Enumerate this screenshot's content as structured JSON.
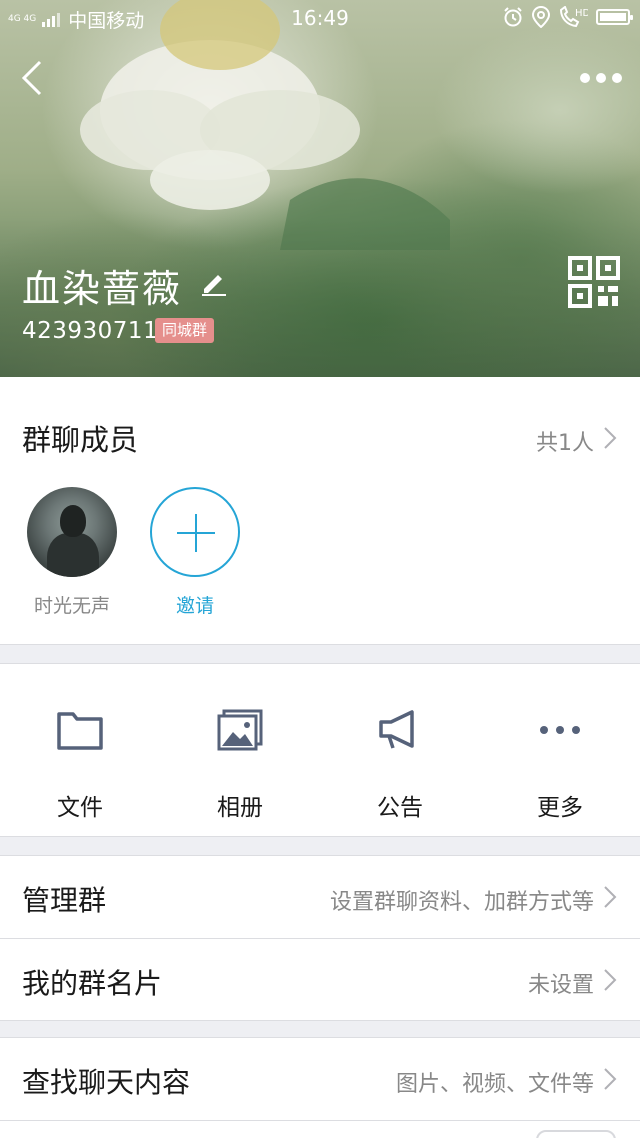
{
  "status_bar": {
    "network": "4G 4G",
    "carrier": "中国移动",
    "time": "16:49",
    "indicators": [
      "alarm-icon",
      "location-icon",
      "call-hd-icon",
      "battery-icon"
    ],
    "hd_label": "HD"
  },
  "header": {
    "group_name": "血染蔷薇",
    "group_id": "423930711",
    "badge": "同城群"
  },
  "members": {
    "title": "群聊成员",
    "count": "共1人",
    "list": [
      {
        "name": "时光无声"
      }
    ],
    "invite_label": "邀请"
  },
  "actions": [
    {
      "label": "文件",
      "icon": "folder-icon"
    },
    {
      "label": "相册",
      "icon": "album-icon"
    },
    {
      "label": "公告",
      "icon": "announcement-icon"
    },
    {
      "label": "更多",
      "icon": "more-dots-icon"
    }
  ],
  "settings": {
    "manage": {
      "label": "管理群",
      "value": "设置群聊资料、加群方式等"
    },
    "card": {
      "label": "我的群名片",
      "value": "未设置"
    },
    "search": {
      "label": "查找聊天内容",
      "value": "图片、视频、文件等"
    }
  },
  "colors": {
    "accent": "#25a5d6",
    "badge": "#e58f8c",
    "icon": "#56627a",
    "background": "#eeeff3"
  }
}
